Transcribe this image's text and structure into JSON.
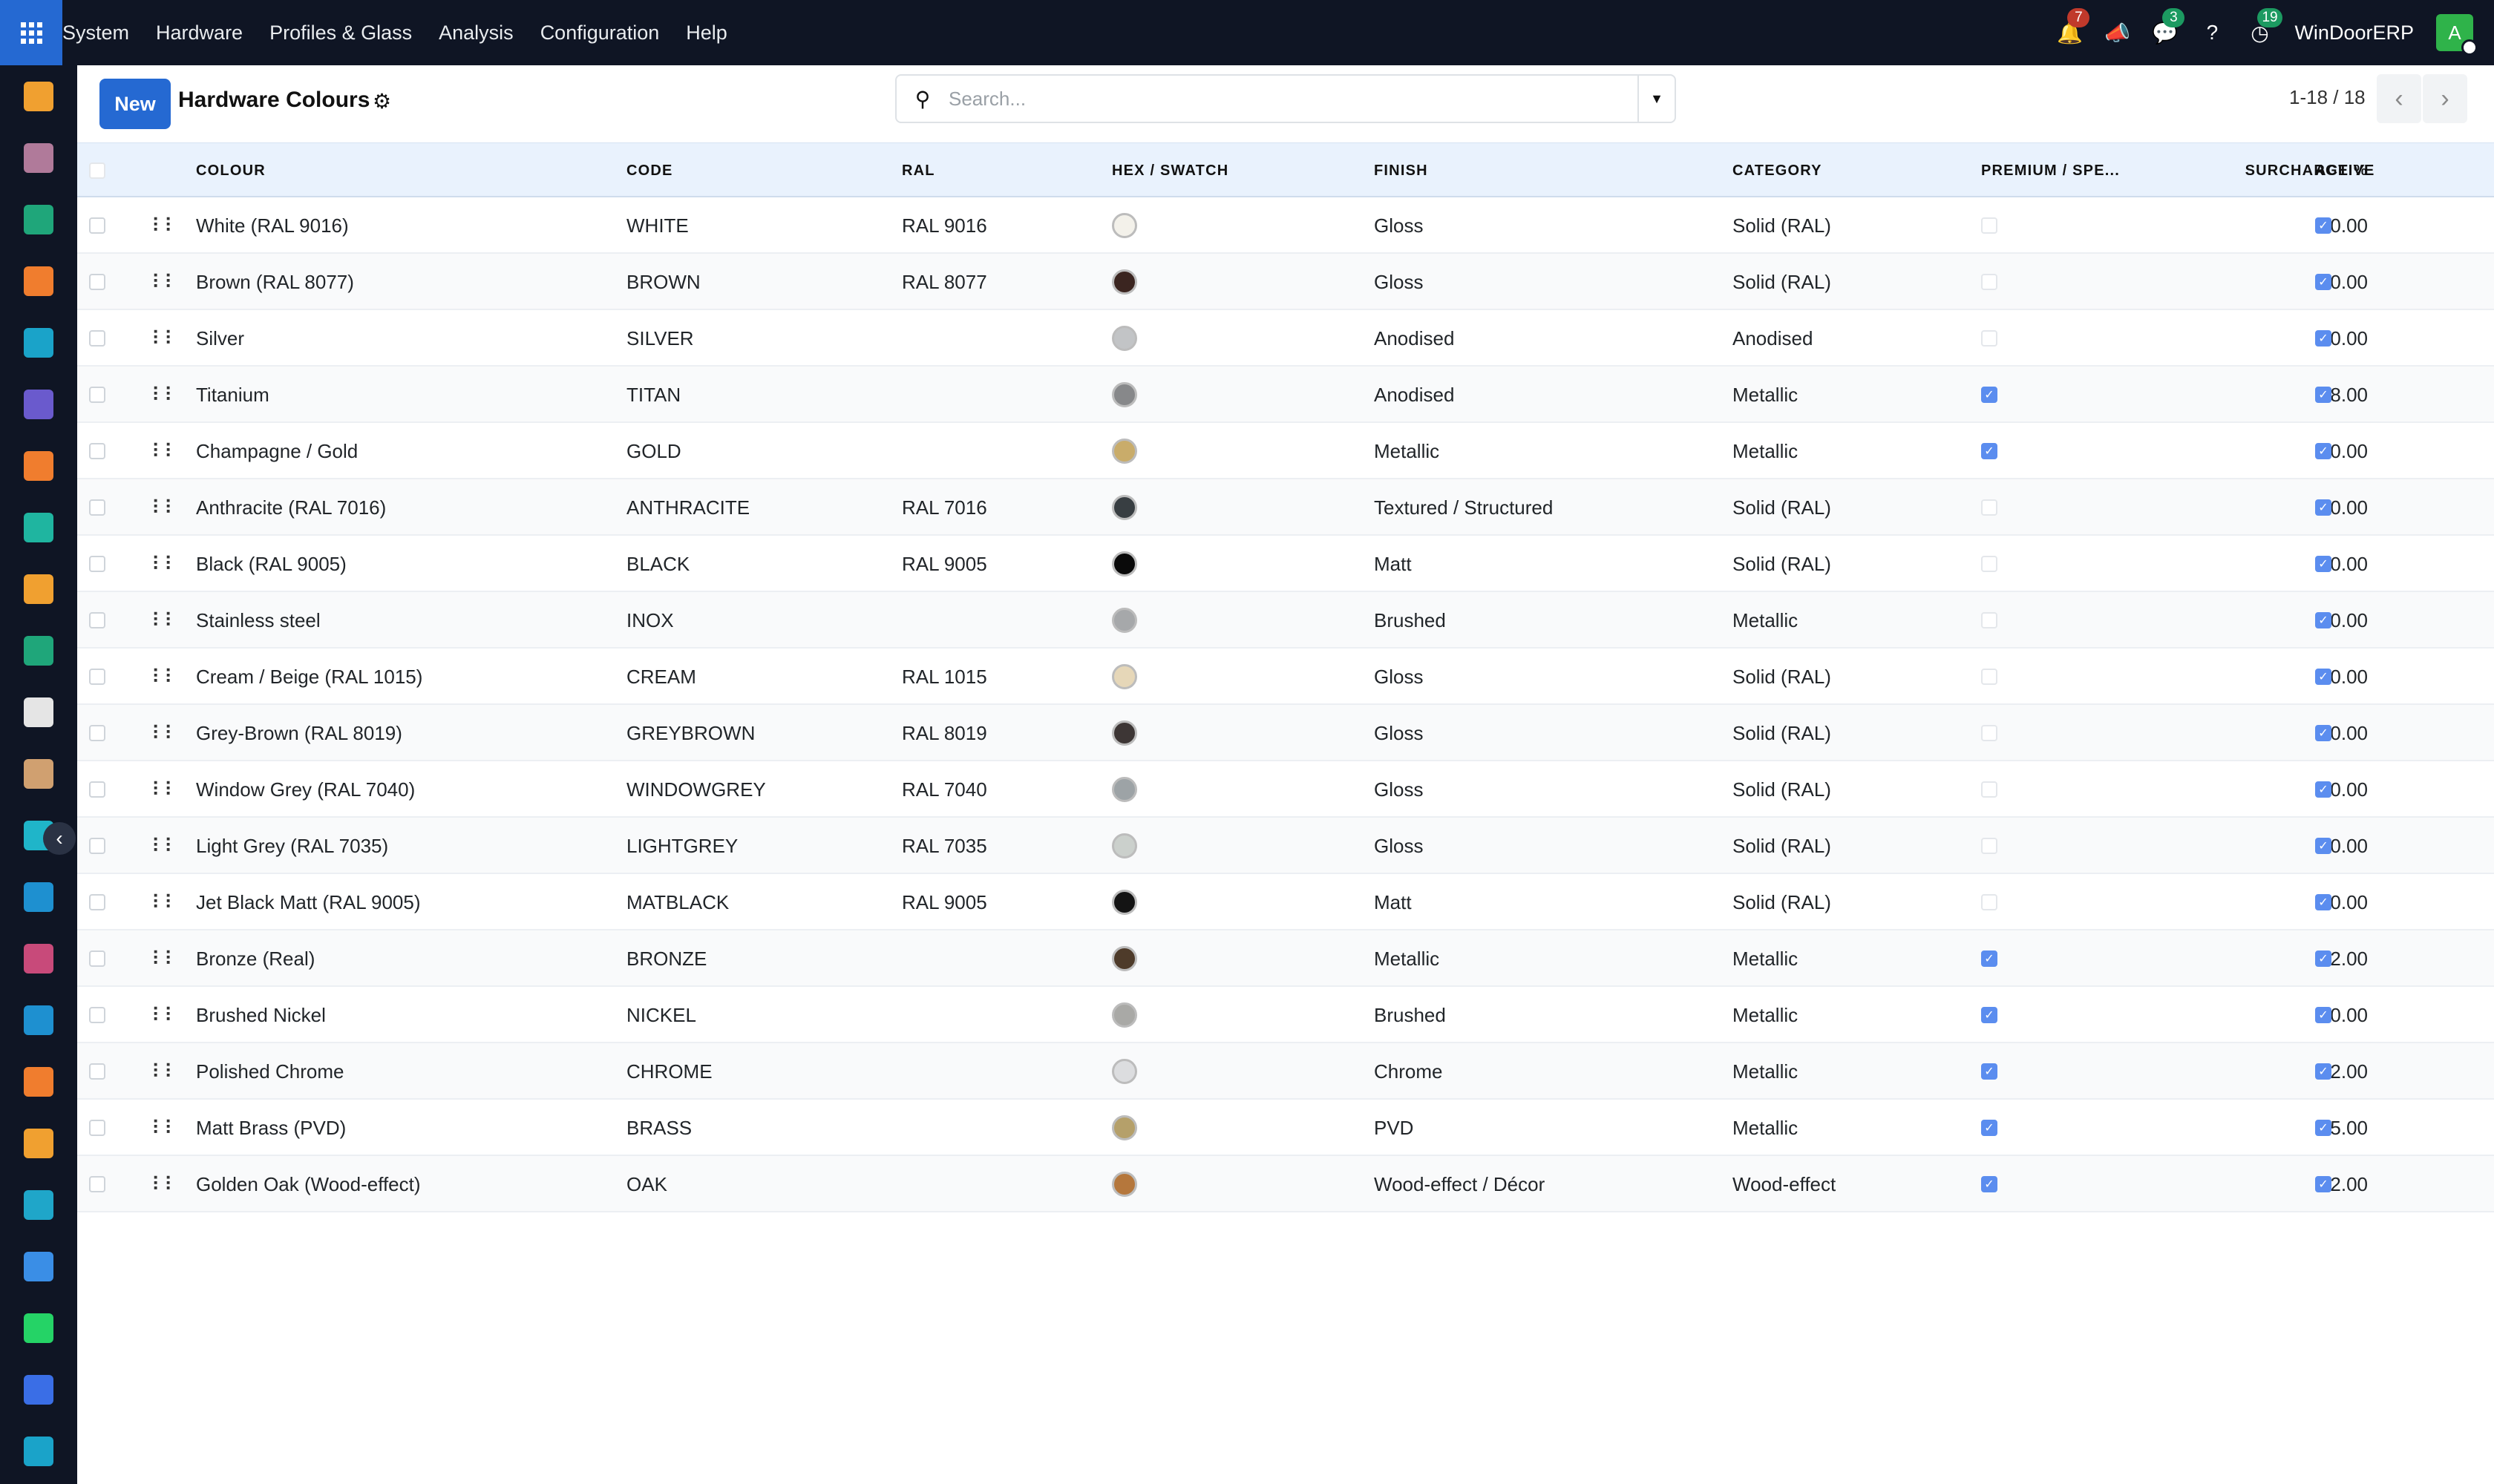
{
  "menu": {
    "apps_icon": "apps-grid-icon",
    "items": [
      "System",
      "Hardware",
      "Profiles & Glass",
      "Analysis",
      "Configuration",
      "Help"
    ]
  },
  "systray": {
    "notifications": "7",
    "messages": "3",
    "activities": "19",
    "company": "WinDoorERP",
    "avatar_letter": "A"
  },
  "control": {
    "new_label": "New",
    "title": "Hardware Colours",
    "search_placeholder": "Search...",
    "pager": "1-18 / 18"
  },
  "columns": {
    "colour": "COLOUR",
    "code": "CODE",
    "ral": "RAL",
    "hex": "HEX / SWATCH",
    "finish": "FINISH",
    "category": "CATEGORY",
    "premium": "PREMIUM / SPE...",
    "surcharge": "SURCHARGE %",
    "active": "ACTIVE"
  },
  "colors": {
    "accent": "#2569d2",
    "topbar": "#0f1524",
    "header_bg": "#e9f2fd",
    "checkbox": "#5b8def"
  },
  "rows": [
    {
      "colour": "White (RAL 9016)",
      "code": "WHITE",
      "ral": "RAL 9016",
      "swatch": "#f3f1ea",
      "finish": "Gloss",
      "category": "Solid (RAL)",
      "premium": false,
      "surcharge": "0.00",
      "active": true
    },
    {
      "colour": "Brown (RAL 8077)",
      "code": "BROWN",
      "ral": "RAL 8077",
      "swatch": "#3b2520",
      "finish": "Gloss",
      "category": "Solid (RAL)",
      "premium": false,
      "surcharge": "0.00",
      "active": true
    },
    {
      "colour": "Silver",
      "code": "SILVER",
      "ral": "",
      "swatch": "#c2c4c6",
      "finish": "Anodised",
      "category": "Anodised",
      "premium": false,
      "surcharge": "0.00",
      "active": true
    },
    {
      "colour": "Titanium",
      "code": "TITAN",
      "ral": "",
      "swatch": "#87888a",
      "finish": "Anodised",
      "category": "Metallic",
      "premium": true,
      "surcharge": "8.00",
      "active": true
    },
    {
      "colour": "Champagne / Gold",
      "code": "GOLD",
      "ral": "",
      "swatch": "#c9ac6a",
      "finish": "Metallic",
      "category": "Metallic",
      "premium": true,
      "surcharge": "10.00",
      "active": true
    },
    {
      "colour": "Anthracite (RAL 7016)",
      "code": "ANTHRACITE",
      "ral": "RAL 7016",
      "swatch": "#383e42",
      "finish": "Textured / Structured",
      "category": "Solid (RAL)",
      "premium": false,
      "surcharge": "0.00",
      "active": true
    },
    {
      "colour": "Black (RAL 9005)",
      "code": "BLACK",
      "ral": "RAL 9005",
      "swatch": "#0a0a0a",
      "finish": "Matt",
      "category": "Solid (RAL)",
      "premium": false,
      "surcharge": "0.00",
      "active": true
    },
    {
      "colour": "Stainless steel",
      "code": "INOX",
      "ral": "",
      "swatch": "#a6a8aa",
      "finish": "Brushed",
      "category": "Metallic",
      "premium": false,
      "surcharge": "0.00",
      "active": true
    },
    {
      "colour": "Cream / Beige (RAL 1015)",
      "code": "CREAM",
      "ral": "RAL 1015",
      "swatch": "#e6d7b8",
      "finish": "Gloss",
      "category": "Solid (RAL)",
      "premium": false,
      "surcharge": "0.00",
      "active": true
    },
    {
      "colour": "Grey-Brown (RAL 8019)",
      "code": "GREYBROWN",
      "ral": "RAL 8019",
      "swatch": "#3d3635",
      "finish": "Gloss",
      "category": "Solid (RAL)",
      "premium": false,
      "surcharge": "0.00",
      "active": true
    },
    {
      "colour": "Window Grey (RAL 7040)",
      "code": "WINDOWGREY",
      "ral": "RAL 7040",
      "swatch": "#9da3a6",
      "finish": "Gloss",
      "category": "Solid (RAL)",
      "premium": false,
      "surcharge": "0.00",
      "active": true
    },
    {
      "colour": "Light Grey (RAL 7035)",
      "code": "LIGHTGREY",
      "ral": "RAL 7035",
      "swatch": "#cbd0cc",
      "finish": "Gloss",
      "category": "Solid (RAL)",
      "premium": false,
      "surcharge": "0.00",
      "active": true
    },
    {
      "colour": "Jet Black Matt (RAL 9005)",
      "code": "MATBLACK",
      "ral": "RAL 9005",
      "swatch": "#141414",
      "finish": "Matt",
      "category": "Solid (RAL)",
      "premium": false,
      "surcharge": "0.00",
      "active": true
    },
    {
      "colour": "Bronze (Real)",
      "code": "BRONZE",
      "ral": "",
      "swatch": "#4e3b2a",
      "finish": "Metallic",
      "category": "Metallic",
      "premium": true,
      "surcharge": "12.00",
      "active": true
    },
    {
      "colour": "Brushed Nickel",
      "code": "NICKEL",
      "ral": "",
      "swatch": "#a9a9a6",
      "finish": "Brushed",
      "category": "Metallic",
      "premium": true,
      "surcharge": "10.00",
      "active": true
    },
    {
      "colour": "Polished Chrome",
      "code": "CHROME",
      "ral": "",
      "swatch": "#dcdddf",
      "finish": "Chrome",
      "category": "Metallic",
      "premium": true,
      "surcharge": "12.00",
      "active": true
    },
    {
      "colour": "Matt Brass (PVD)",
      "code": "BRASS",
      "ral": "",
      "swatch": "#b5a06a",
      "finish": "PVD",
      "category": "Metallic",
      "premium": true,
      "surcharge": "15.00",
      "active": true
    },
    {
      "colour": "Golden Oak (Wood-effect)",
      "code": "OAK",
      "ral": "",
      "swatch": "#b5773c",
      "finish": "Wood-effect / Décor",
      "category": "Wood-effect",
      "premium": true,
      "surcharge": "12.00",
      "active": true
    }
  ],
  "sidebar": [
    {
      "name": "sales-app-icon",
      "color": "#f0a030"
    },
    {
      "name": "pos-app-icon",
      "color": "#b07a9a"
    },
    {
      "name": "contacts-app-icon",
      "color": "#1fa67a"
    },
    {
      "name": "discuss-app-icon",
      "color": "#f07d2e"
    },
    {
      "name": "website-app-icon",
      "color": "#1aa3c9"
    },
    {
      "name": "email-marketing-app-icon",
      "color": "#6a5acd"
    },
    {
      "name": "live-chat-app-icon",
      "color": "#f07d2e"
    },
    {
      "name": "project-app-icon",
      "color": "#1fb5a0"
    },
    {
      "name": "reporting-app-icon",
      "color": "#f0a030"
    },
    {
      "name": "employees-app-icon",
      "color": "#1fa67a"
    },
    {
      "name": "inventory-app-icon",
      "color": "#e5e5e5"
    },
    {
      "name": "pos-shop-app-icon",
      "color": "#d0a070"
    },
    {
      "name": "todo-app-icon",
      "color": "#1fb5c9"
    },
    {
      "name": "knowledge-app-icon",
      "color": "#1e90d0"
    },
    {
      "name": "packages-app-icon",
      "color": "#c84a7a"
    },
    {
      "name": "invoicing-app-icon",
      "color": "#1e90d0"
    },
    {
      "name": "team-app-icon",
      "color": "#f07d2e"
    },
    {
      "name": "calendar-app-icon",
      "color": "#f0a030"
    },
    {
      "name": "sign-app-icon",
      "color": "#1fa6c9"
    },
    {
      "name": "dashboard-app-icon",
      "color": "#3a8ee6"
    },
    {
      "name": "whatsapp-app-icon",
      "color": "#25d366"
    },
    {
      "name": "timer-app-icon",
      "color": "#3a6ee6"
    },
    {
      "name": "website-builder-app-icon",
      "color": "#1aa3c9"
    }
  ]
}
